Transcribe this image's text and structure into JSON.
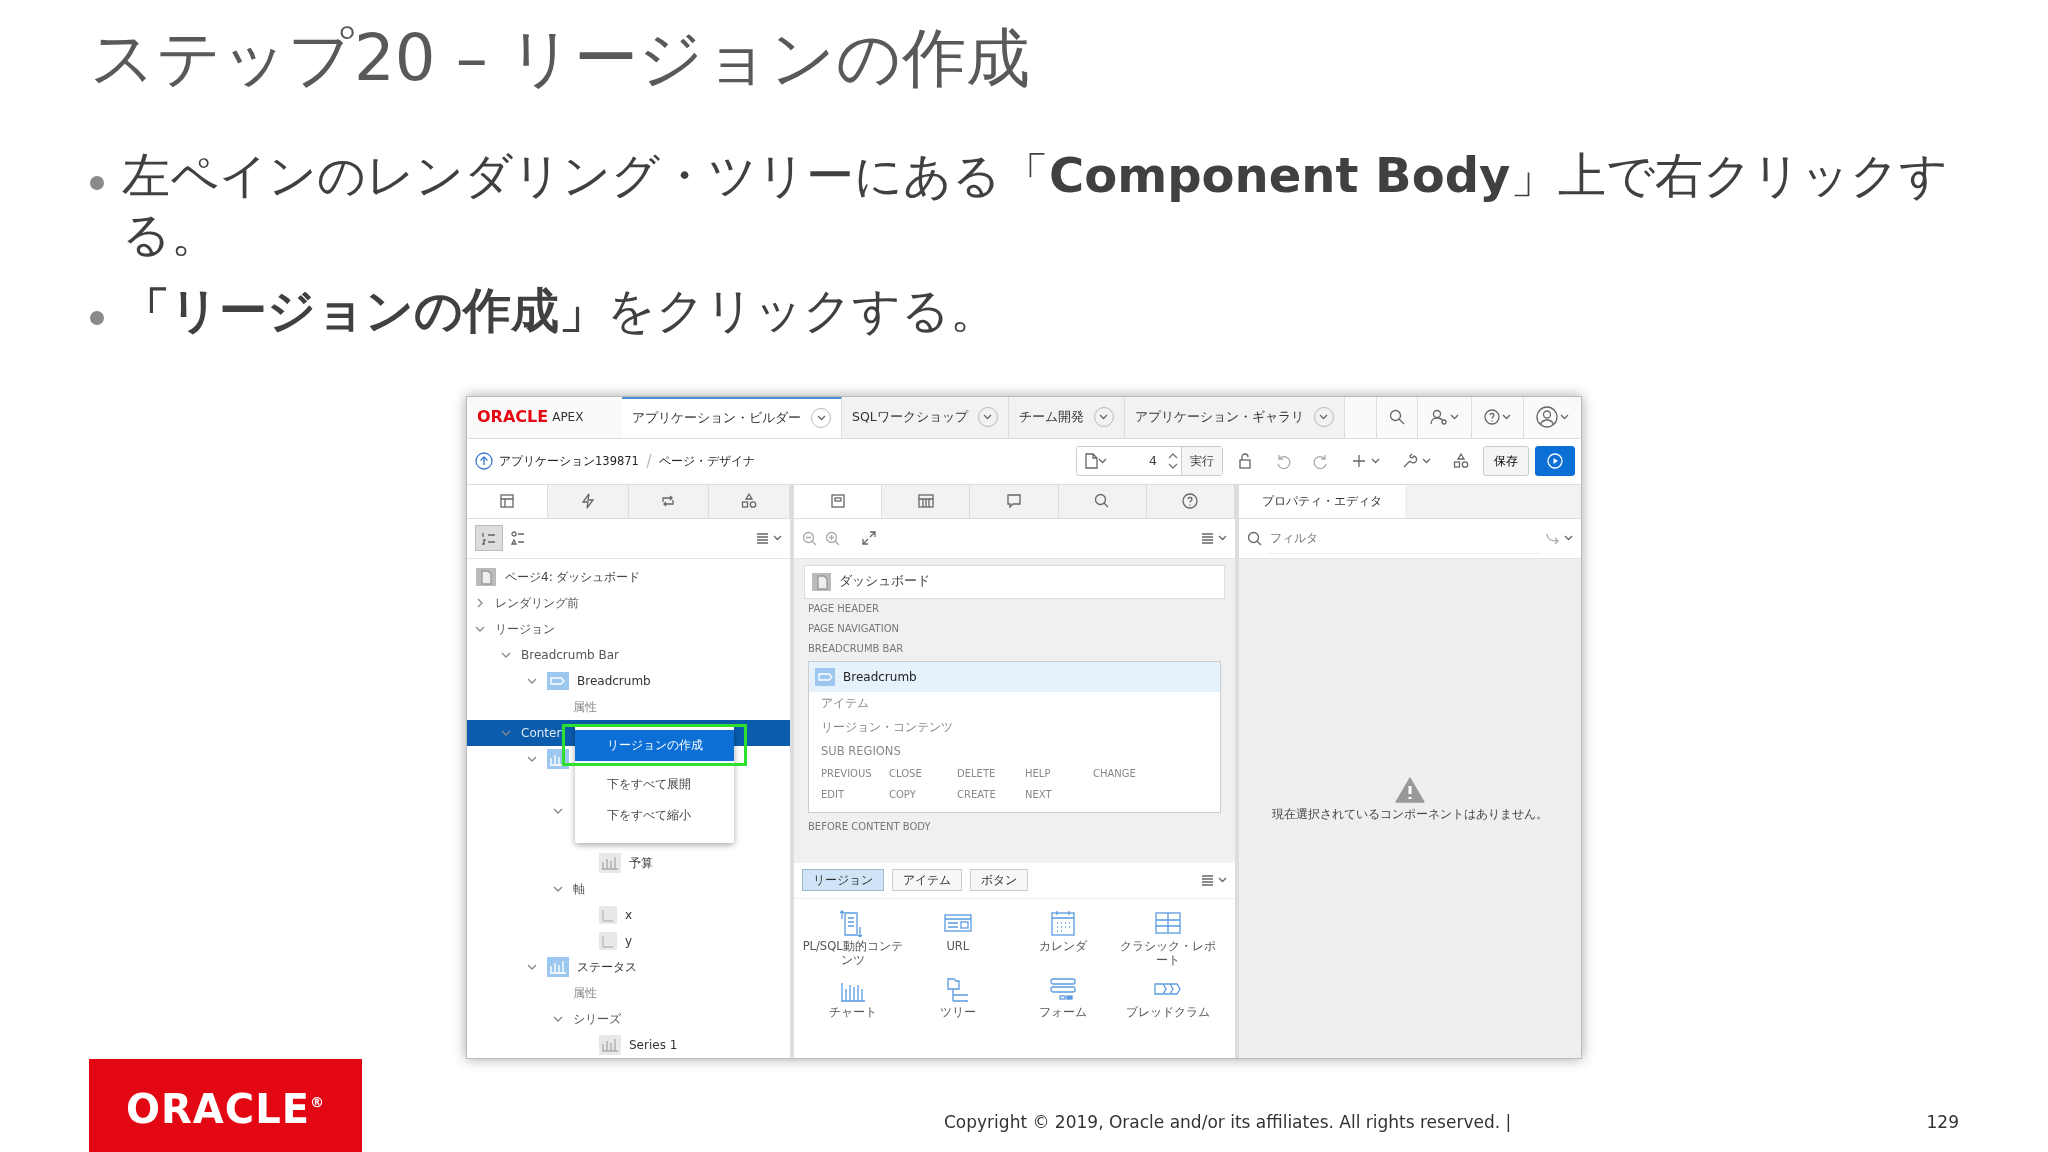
{
  "slide": {
    "title": "ステップ20 – リージョンの作成",
    "bullets": [
      "左ペインのレンダリング・ツリーにある「**Component Body**」上で右クリックする。",
      "**「リージョンの作成」**をクリックする。"
    ],
    "logo": "ORACLE",
    "logo_mark": "®",
    "copyright": "Copyright © 2019, Oracle and/or its affiliates. All rights reserved.  |",
    "page_number": "129"
  },
  "app": {
    "brand": {
      "logo": "ORACLE",
      "product": "APEX"
    },
    "nav_tabs": [
      {
        "label": "アプリケーション・ビルダー",
        "selected": true
      },
      {
        "label": "SQLワークショップ",
        "selected": false
      },
      {
        "label": "チーム開発",
        "selected": false
      },
      {
        "label": "アプリケーション・ギャラリ",
        "selected": false
      }
    ],
    "breadcrumb": [
      "アプリケーション139871",
      "ページ・デザイナ"
    ],
    "page_field": "4",
    "run_label": "実行",
    "save_label": "保存",
    "left_tabs": [
      {
        "kind": "rendering",
        "selected": true
      },
      {
        "kind": "actions",
        "selected": false
      },
      {
        "kind": "processing",
        "selected": false
      },
      {
        "kind": "shared",
        "selected": false
      }
    ],
    "tree": [
      {
        "kind": "page",
        "label": "ページ4: ダッシュボード",
        "selected": false,
        "children": [
          {
            "kind": "folder",
            "label": "レンダリング前",
            "expanded": false,
            "selected": false
          },
          {
            "kind": "folder",
            "label": "リージョン",
            "expanded": true,
            "selected": false,
            "children": [
              {
                "kind": "folder",
                "label": "Breadcrumb Bar",
                "expanded": true,
                "selected": false,
                "children": [
                  {
                    "kind": "breadcrumb",
                    "label": "Breadcrumb",
                    "expanded": true,
                    "selected": false,
                    "children": [
                      {
                        "kind": "attribute",
                        "label": "属性",
                        "selected": false
                      }
                    ]
                  }
                ]
              },
              {
                "kind": "folder",
                "label": "Conten",
                "expanded": true,
                "selected": true,
                "children": [
                  {
                    "kind": "chart",
                    "expanded": true,
                    "selected": false,
                    "children": [
                      {
                        "kind": "covered"
                      },
                      {
                        "kind": "folder",
                        "expanded": true,
                        "selected": false,
                        "children": [
                          {
                            "kind": "covered"
                          },
                          {
                            "kind": "series",
                            "label": "予算",
                            "selected": false
                          }
                        ]
                      },
                      {
                        "kind": "folder",
                        "label": "軸",
                        "expanded": true,
                        "selected": false,
                        "children": [
                          {
                            "kind": "axis",
                            "label": "x",
                            "selected": false
                          },
                          {
                            "kind": "axis",
                            "label": "y",
                            "selected": false
                          }
                        ]
                      }
                    ]
                  },
                  {
                    "kind": "chart",
                    "label": "ステータス",
                    "expanded": true,
                    "selected": false,
                    "children": [
                      {
                        "kind": "attribute",
                        "label": "属性",
                        "selected": false
                      },
                      {
                        "kind": "folder",
                        "label": "シリーズ",
                        "expanded": true,
                        "selected": false,
                        "children": [
                          {
                            "kind": "series",
                            "label": "Series 1",
                            "selected": false
                          }
                        ]
                      }
                    ]
                  }
                ]
              }
            ]
          }
        ]
      }
    ],
    "context_menu": [
      {
        "label": "リージョンの作成",
        "selected": true
      },
      {
        "label": "下をすべて展開",
        "selected": false
      },
      {
        "label": "下をすべて縮小",
        "selected": false
      }
    ],
    "middle_tabs": [
      {
        "kind": "grid",
        "selected": true
      },
      {
        "kind": "components",
        "selected": false
      },
      {
        "kind": "comments",
        "selected": false
      },
      {
        "kind": "search",
        "selected": false
      },
      {
        "kind": "help",
        "selected": false
      }
    ],
    "layout": {
      "page_title": "ダッシュボード",
      "positions": [
        "PAGE HEADER",
        "PAGE NAVIGATION",
        "BREADCRUMB BAR"
      ],
      "region": {
        "title": "Breadcrumb",
        "slots": [
          "アイテム",
          "リージョン・コンテンツ",
          "SUB REGIONS"
        ],
        "buttons": [
          [
            "PREVIOUS",
            "CLOSE",
            "DELETE",
            "HELP",
            "CHANGE"
          ],
          [
            "EDIT",
            "COPY",
            "CREATE",
            "NEXT"
          ]
        ]
      },
      "after": "BEFORE CONTENT BODY"
    },
    "gallery_tabs": [
      {
        "label": "リージョン",
        "selected": true
      },
      {
        "label": "アイテム",
        "selected": false
      },
      {
        "label": "ボタン",
        "selected": false
      }
    ],
    "gallery": [
      {
        "kind": "plsql",
        "label": "PL/SQL動的コンテンツ"
      },
      {
        "kind": "url",
        "label": "URL"
      },
      {
        "kind": "calendar",
        "label": "カレンダ"
      },
      {
        "kind": "report",
        "label": "クラシック・レポート"
      },
      {
        "kind": "chart",
        "label": "チャート"
      },
      {
        "kind": "tree",
        "label": "ツリー"
      },
      {
        "kind": "form",
        "label": "フォーム"
      },
      {
        "kind": "breadcrumb",
        "label": "ブレッドクラム"
      }
    ],
    "property_tab": "プロパティ・エディタ",
    "filter_placeholder": "フィルタ",
    "empty_message": "現在選択されているコンポーネントはありません。"
  }
}
